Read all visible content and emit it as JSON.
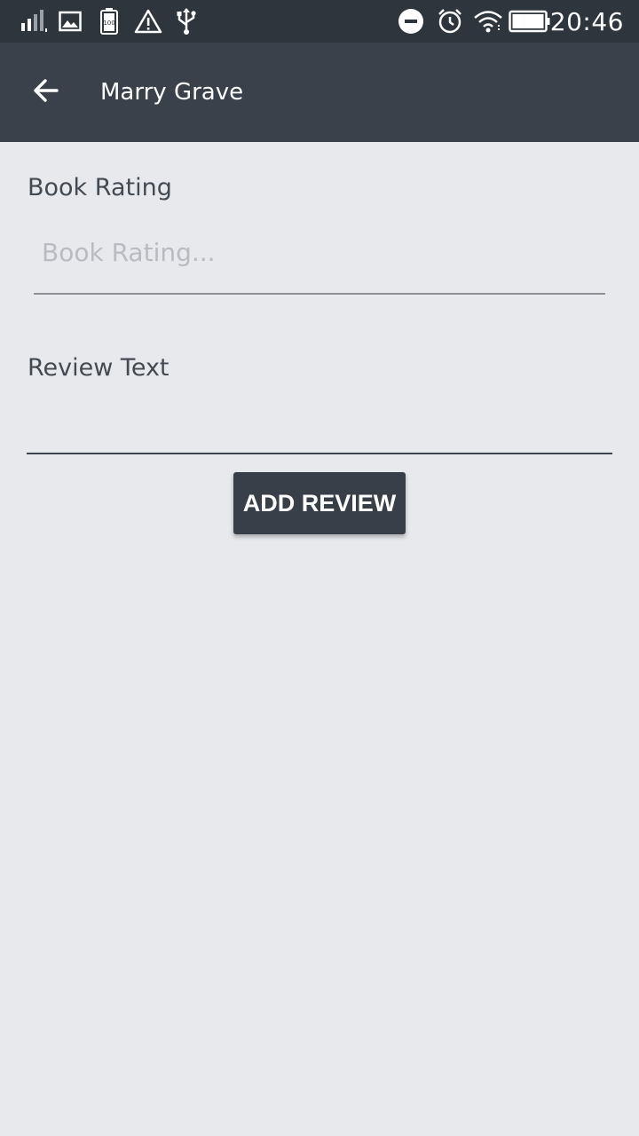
{
  "status_bar": {
    "time": "20:46",
    "left_icons": [
      "signal-icon",
      "image-icon",
      "battery-saver-icon",
      "warning-icon",
      "usb-icon"
    ],
    "right_icons": [
      "do-not-disturb-icon",
      "alarm-icon",
      "wifi-icon",
      "battery-icon"
    ],
    "battery_saver_text": "100"
  },
  "app_bar": {
    "title": "Marry Grave",
    "back_icon": "arrow-back-icon",
    "background": "#3b414b"
  },
  "form": {
    "rating_label": "Book Rating",
    "rating_value": "",
    "rating_placeholder": "Book Rating...",
    "review_label": "Review Text",
    "review_value": "",
    "submit_label": "ADD REVIEW"
  },
  "colors": {
    "status_bar": "#2f353d",
    "app_bar": "#3b414b",
    "background": "#e8e9ed",
    "button": "#393f48"
  }
}
